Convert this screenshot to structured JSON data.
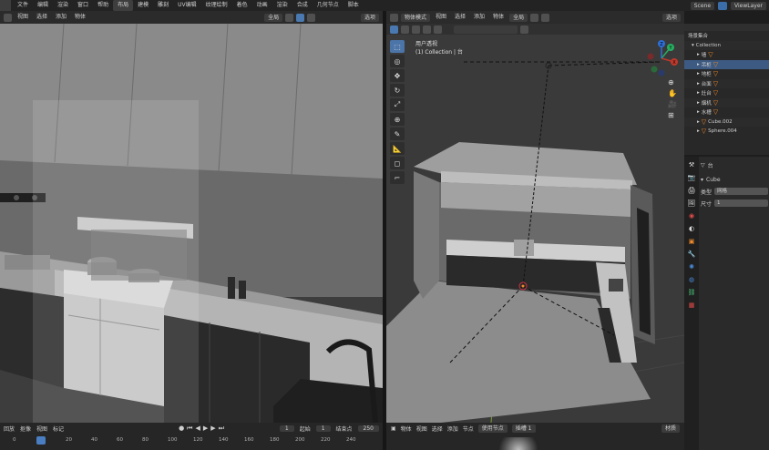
{
  "topbar": {
    "menus": [
      "文件",
      "编辑",
      "渲染",
      "窗口",
      "帮助"
    ],
    "workspace_tabs": [
      "布局",
      "建模",
      "雕刻",
      "UV编辑",
      "纹理绘制",
      "着色",
      "动画",
      "渲染",
      "合成",
      "几何节点",
      "脚本"
    ],
    "scene": "Scene",
    "view_layer": "ViewLayer"
  },
  "left_header": {
    "items": [
      "视图",
      "选择",
      "添加",
      "物体"
    ],
    "transform": "全局",
    "options": "选项"
  },
  "right_header": {
    "mode": "物体模式",
    "items": [
      "视图",
      "选择",
      "添加",
      "物体"
    ],
    "transform": "全局",
    "options": "选项"
  },
  "right_viewport": {
    "overlay_line1": "用户透视",
    "overlay_line2": "(1) Collection | 台"
  },
  "gizmo": {
    "x": "X",
    "y": "Y",
    "z": "Z"
  },
  "outliner": {
    "rows": [
      {
        "label": "场景集合"
      },
      {
        "label": "Collection"
      },
      {
        "label": "墙"
      },
      {
        "label": "吊柜"
      },
      {
        "label": "地柜"
      },
      {
        "label": "台面"
      },
      {
        "label": "灶台"
      },
      {
        "label": "烟机"
      },
      {
        "label": "水槽"
      },
      {
        "label": "Cube.002"
      },
      {
        "label": "Sphere.004"
      }
    ]
  },
  "properties": {
    "object_name": "台",
    "section": "Cube",
    "fields": [
      {
        "label": "类型",
        "value": "网格"
      },
      {
        "label": "尺寸",
        "value": "1"
      }
    ]
  },
  "timeline": {
    "items": [
      "回放",
      "抠像",
      "视图",
      "标记"
    ],
    "current_frame": "1",
    "start_label": "起始",
    "start": "1",
    "end_label": "结束点",
    "end": "250",
    "ruler": [
      "0",
      "20",
      "40",
      "60",
      "80",
      "100",
      "120",
      "140",
      "160",
      "180",
      "200",
      "220",
      "240"
    ]
  },
  "shader": {
    "items": [
      "物体",
      "视图",
      "选择",
      "添加",
      "节点"
    ],
    "use_nodes": "使用节点",
    "slot": "插槽 1",
    "material": "材质"
  },
  "colors": {
    "accent": "#4b74a8",
    "selection_orange": "#f08a2a",
    "viewport_bg": "#3d3d3d"
  }
}
